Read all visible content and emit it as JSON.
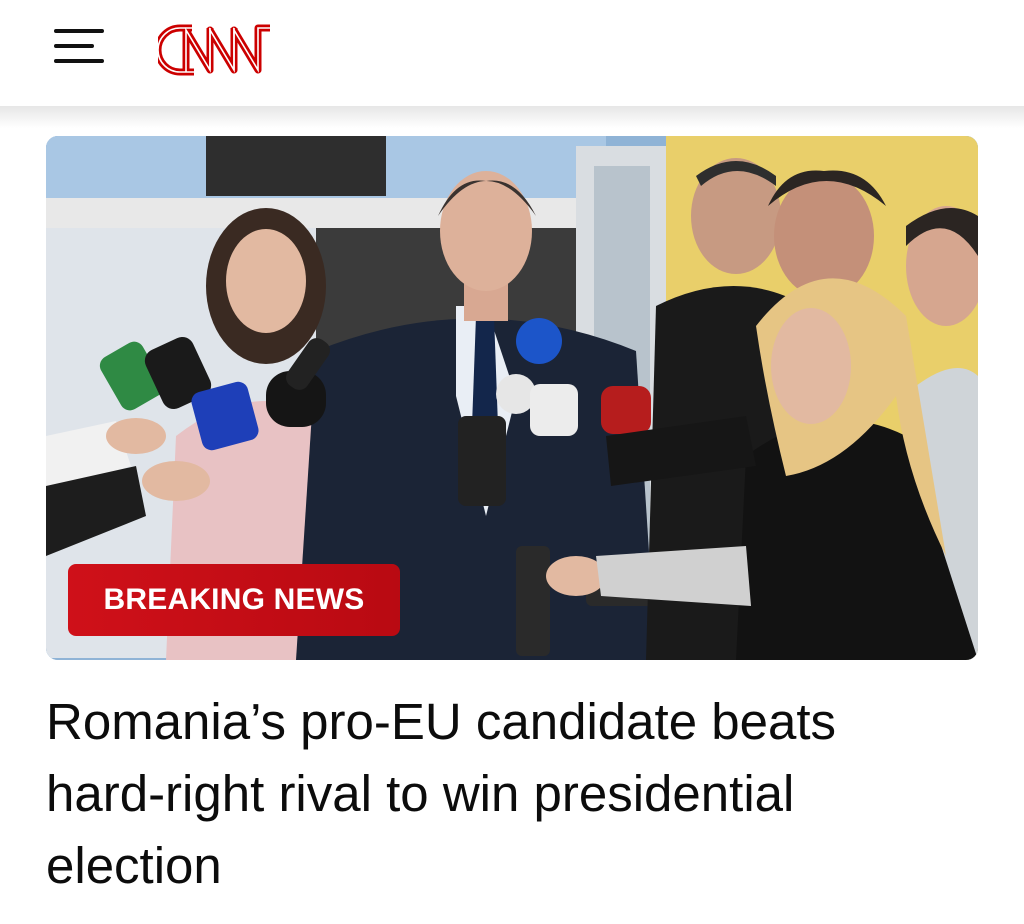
{
  "header": {
    "menu_icon": "hamburger-menu-icon",
    "logo_text": "CNN",
    "brand_color": "#cc0000"
  },
  "hero": {
    "badge_label": "BREAKING NEWS",
    "badge_color": "#cc0000"
  },
  "article": {
    "headline": "Romania’s pro-EU candidate beats hard-right rival to win presidential election"
  }
}
